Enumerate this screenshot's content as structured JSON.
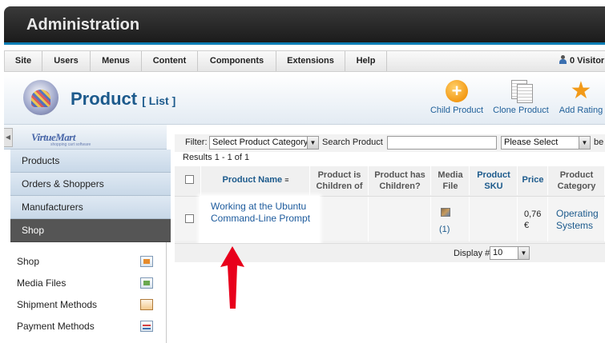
{
  "header": {
    "title": "Administration"
  },
  "menu": {
    "items": [
      "Site",
      "Users",
      "Menus",
      "Content",
      "Components",
      "Extensions",
      "Help"
    ],
    "visitors": "0 Visitor"
  },
  "toolbar": {
    "page_title": "Product",
    "page_subtitle": "[ List ]",
    "buttons": [
      {
        "label": "Child Product",
        "icon": "plus-circle-icon"
      },
      {
        "label": "Clone Product",
        "icon": "clone-documents-icon"
      },
      {
        "label": "Add Rating",
        "icon": "star-icon"
      }
    ]
  },
  "sidebar": {
    "logo_text": "VirtueMart",
    "logo_sub": "shopping cart software",
    "collapse_glyph": "◀",
    "sections": [
      "Products",
      "Orders & Shoppers",
      "Manufacturers",
      "Shop"
    ],
    "active_section": "Shop",
    "items": [
      {
        "label": "Shop",
        "icon": "shop-icon"
      },
      {
        "label": "Media Files",
        "icon": "media-icon"
      },
      {
        "label": "Shipment Methods",
        "icon": "truck-icon"
      },
      {
        "label": "Payment Methods",
        "icon": "payment-icon"
      }
    ]
  },
  "filter": {
    "label": "Filter:",
    "category_value": "Select Product Category",
    "search_label": "Search Product",
    "search_value": "",
    "please_select": "Please Select",
    "trailing": "be"
  },
  "results_text": "Results 1 - 1 of 1",
  "table": {
    "headers": [
      "Product Name",
      "Product is Children of",
      "Product has Children?",
      "Media File",
      "Product SKU",
      "Price",
      "Product Category"
    ],
    "rows": [
      {
        "product_name": "Working at the Ubuntu Command-Line Prompt",
        "children_of": "",
        "has_children": "",
        "media_count": "(1)",
        "sku": "",
        "price": "0,76 €",
        "category": "Operating Systems"
      }
    ]
  },
  "pagination": {
    "label": "Display #",
    "value": "10"
  },
  "arrow_dropdown_glyph": "▼",
  "accent_color": "#0c7db5",
  "arrow_color": "#e8001c"
}
